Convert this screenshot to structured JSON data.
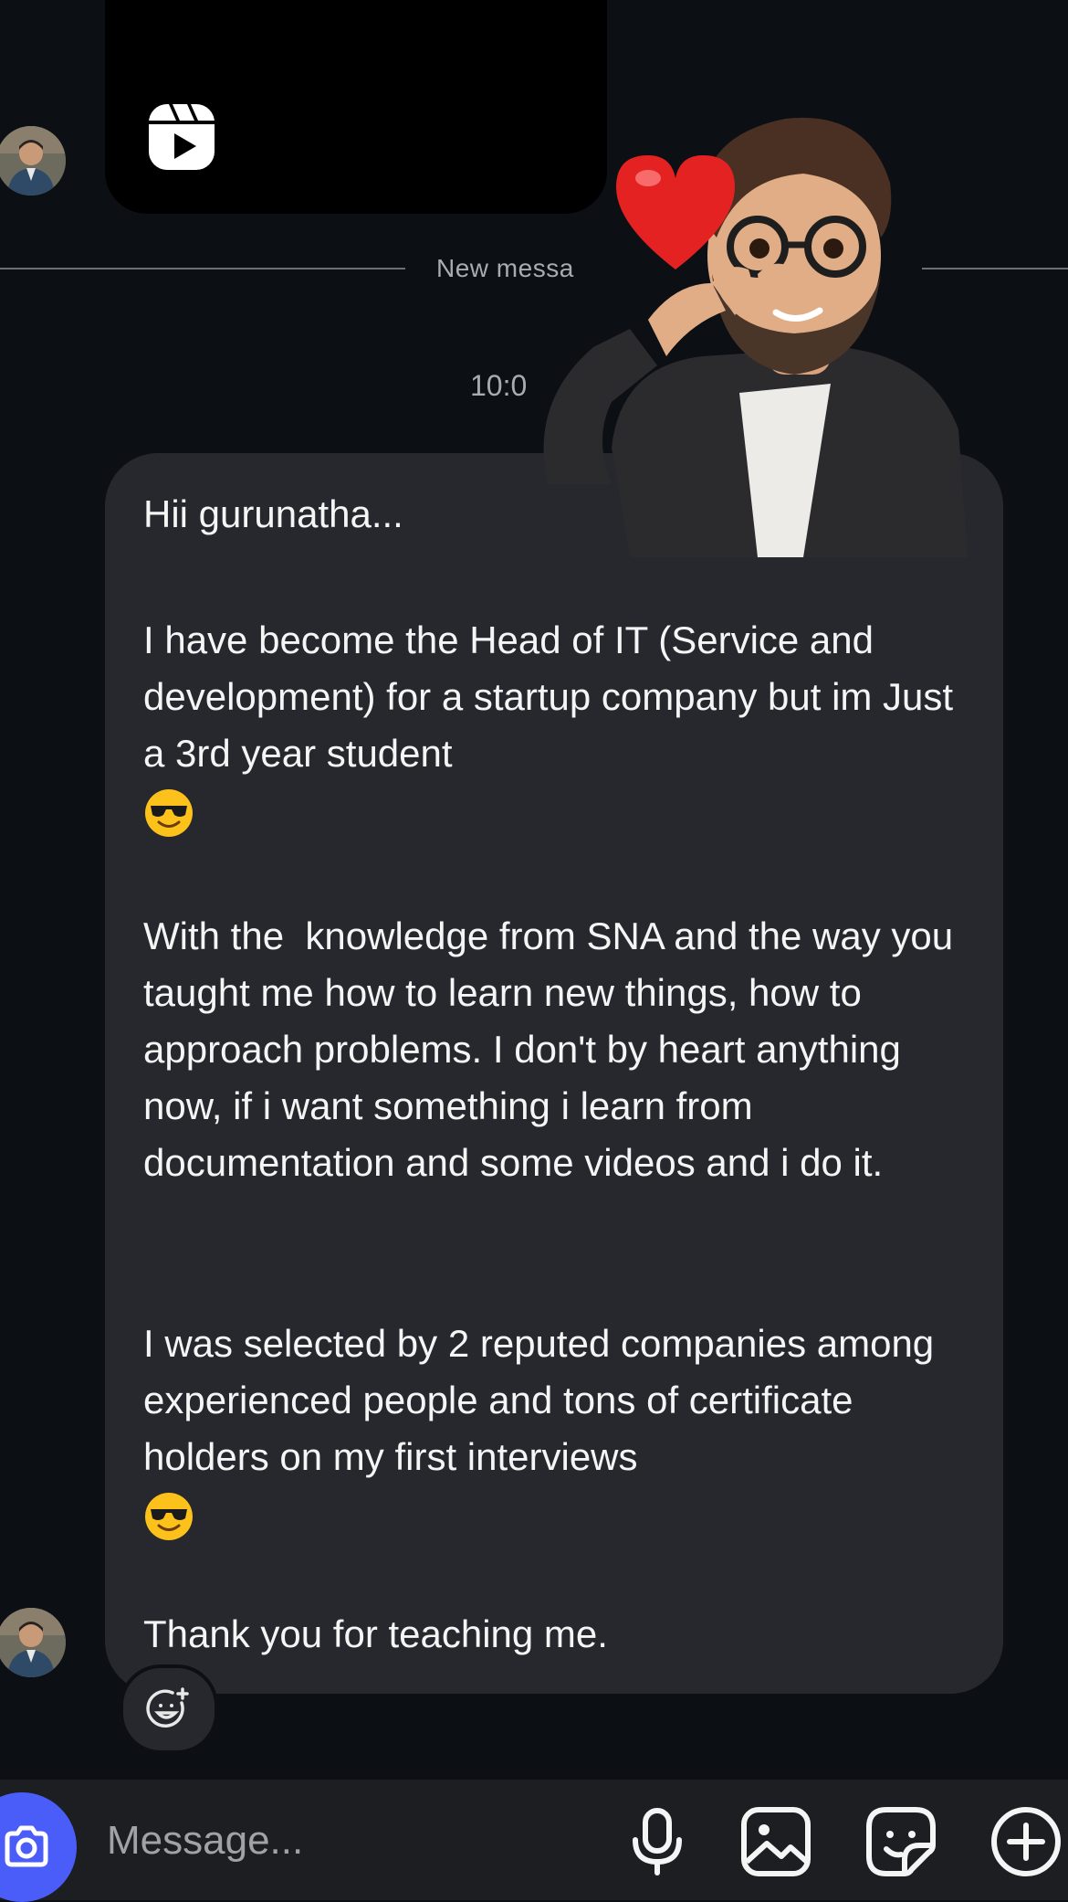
{
  "thread": {
    "divider_label": "New messa",
    "timestamp": "10:0"
  },
  "message": {
    "paragraphs": [
      "Hii gurunatha...",
      "I have become the Head of IT (Service and development) for a startup company but im Just a 3rd year student",
      "With the  knowledge from SNA and the way you taught me how to learn new things, how to approach problems. I don't by heart anything now, if i want something i learn from documentation and some videos and i do it.",
      "I was selected by 2 reputed companies among experienced people and tons of certificate holders on my first interviews",
      "Thank you for teaching me."
    ],
    "emoji": "smiling-face-with-sunglasses"
  },
  "composer": {
    "placeholder": "Message...",
    "icons": [
      "camera-icon",
      "microphone-icon",
      "gallery-icon",
      "sticker-icon",
      "plus-icon"
    ]
  },
  "colors": {
    "background": "#0c1014",
    "bubble": "#26282d",
    "camera_button": "#4a5df9",
    "muted_text": "#a8acb0"
  }
}
